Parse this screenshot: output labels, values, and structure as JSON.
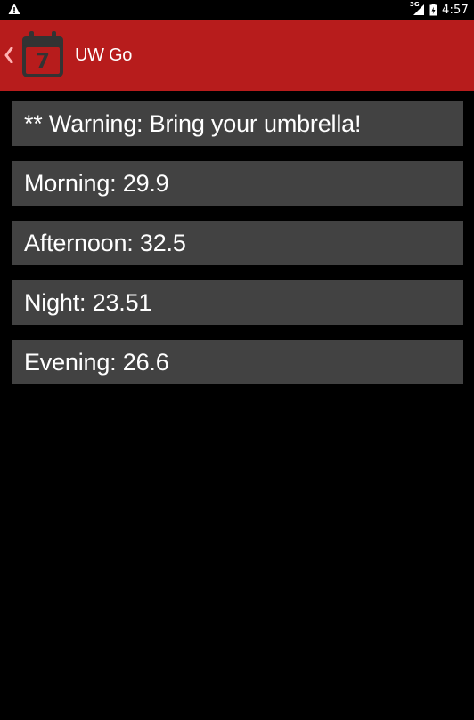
{
  "status_bar": {
    "network_type": "3G",
    "time": "4:57"
  },
  "action_bar": {
    "title": "UW Go",
    "icon_day_number": "7",
    "background_color": "#b71c1c"
  },
  "forecast_items": [
    "** Warning: Bring your umbrella!",
    "Morning: 29.9",
    "Afternoon: 32.5",
    "Night: 23.51",
    "Evening: 26.6"
  ]
}
